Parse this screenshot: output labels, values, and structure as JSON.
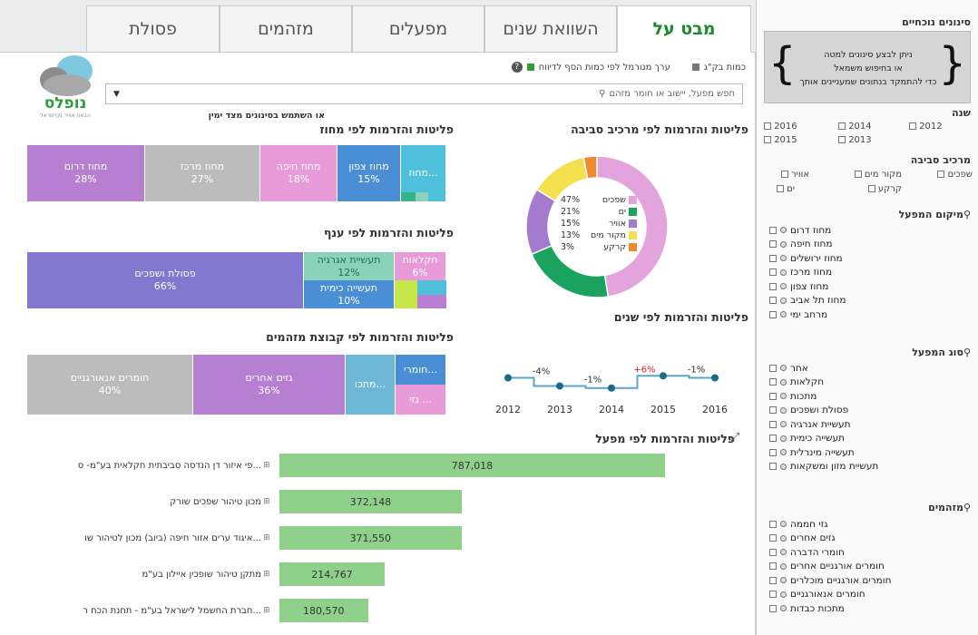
{
  "tabs": [
    {
      "label": "מבט על",
      "active": true
    },
    {
      "label": "השוואת שנים",
      "active": false
    },
    {
      "label": "מפעלים",
      "active": false
    },
    {
      "label": "מזהמים",
      "active": false
    },
    {
      "label": "פסולת",
      "active": false
    }
  ],
  "logo": {
    "text": "נופלס",
    "sub": "הבאת אוויר נקיישראל"
  },
  "legend": {
    "ton": "כמות בק\"ג",
    "normalized": "ערך מנורמל לפי כמות הסף לדיווח"
  },
  "search": {
    "placeholder": "חפש מפעל, יישוב או חומר מזהם",
    "note": "או השתמש בסינונים מצד ימין"
  },
  "sections": {
    "district": "פליטות והזרמות לפי מחוז",
    "env": "פליטות והזרמות לפי מרכיב סביבה",
    "branch": "פליטות והזרמות לפי ענף",
    "years": "פליטות והזרמות לפי שנים",
    "group": "פליטות והזרמות לפי קבוצת מזהמים",
    "factory": "פליטות והזרמות לפי מפעל"
  },
  "district_tiles": [
    {
      "name": "מחוז דרום",
      "pct": "28%",
      "color": "#b67fd1"
    },
    {
      "name": "מחוז מרכז",
      "pct": "27%",
      "color": "#bcbcbc"
    },
    {
      "name": "מחוז חיפה",
      "pct": "18%",
      "color": "#e89ad9"
    },
    {
      "name": "מחוז צפון",
      "pct": "15%",
      "color": "#4a8fd6"
    },
    {
      "name": "מחוז...",
      "pct": "",
      "color": "#4fc0dc"
    }
  ],
  "branch_tiles": [
    {
      "name": "פסולת ושפכים",
      "pct": "66%",
      "color": "#8377cf"
    },
    {
      "name": "תעשיית אגרגיה",
      "pct": "12%",
      "color": "#8ad2b9"
    },
    {
      "name": "תעשייה כימית",
      "pct": "10%",
      "color": "#4a8fd6"
    },
    {
      "name": "חקלאות",
      "pct": "6%",
      "color": "#e89ad9"
    }
  ],
  "group_tiles": [
    {
      "name": "חומרים אנאורגניים",
      "pct": "40%",
      "color": "#bcbcbc"
    },
    {
      "name": "גזים אחרים",
      "pct": "36%",
      "color": "#b67fd1"
    },
    {
      "name": "מתכו...",
      "pct": "",
      "color": "#6fb7d6"
    },
    {
      "name": "חומרי...",
      "pct": "",
      "color": "#4a8fd6"
    },
    {
      "name": "גזי ...",
      "pct": "",
      "color": "#e89ad9"
    }
  ],
  "donut": {
    "legend": [
      {
        "name": "שפכים",
        "pct": "47%",
        "color": "#e3a3dc"
      },
      {
        "name": "ים",
        "pct": "21%",
        "color": "#1aa35f"
      },
      {
        "name": "אוויר",
        "pct": "15%",
        "color": "#a57bd0"
      },
      {
        "name": "מקור מים",
        "pct": "13%",
        "color": "#f5e04f"
      },
      {
        "name": "קרקע",
        "pct": "3%",
        "color": "#f08a30"
      }
    ]
  },
  "chart_data": [
    {
      "type": "line",
      "title": "פליטות והזרמות לפי שנים",
      "x": [
        "2012",
        "2013",
        "2014",
        "2015",
        "2016"
      ],
      "series": [
        {
          "values": [
            100,
            96,
            95,
            101,
            100
          ]
        }
      ],
      "annotations": [
        "-4%",
        "-1%",
        "+6%",
        "-1%"
      ],
      "annotation_colors": [
        "#333",
        "#333",
        "#e0242c",
        "#333"
      ]
    },
    {
      "type": "pie",
      "title": "פליטות והזרמות לפי מרכיב סביבה",
      "categories": [
        "שפכים",
        "ים",
        "אוויר",
        "מקור מים",
        "קרקע"
      ],
      "values": [
        47,
        21,
        15,
        13,
        3
      ]
    },
    {
      "type": "bar",
      "title": "פליטות והזרמות לפי מפעל",
      "categories": [
        "...פי איזור דן הנדסה סביבתית חקלאית בע\"מ- ס",
        "מכון טיהור שפכים שורק",
        "...איגוד ערים אזור חיפה (ביוב) מכון לטיהור שו",
        "מתקן טיהור שופכין איילון בע\"מ",
        "...חברת החשמל לישראל בע\"מ - תחנת הכח ר"
      ],
      "values": [
        787018,
        372148,
        371550,
        214767,
        180570
      ],
      "labels": [
        "787,018",
        "372,148",
        "371,550",
        "214,767",
        "180,570"
      ]
    }
  ],
  "side": {
    "title": "סינונים נוכחיים",
    "info": [
      "ניתן לבצע סינונים למטה",
      "או בחיפוש משמאל",
      "כדי להתמקד בנתונים שמעניינים אותך"
    ],
    "year_title": "שנה",
    "years": [
      "2012",
      "2014",
      "2016",
      "2013",
      "2015"
    ],
    "env_title": "מרכיב סביבה",
    "env": [
      "שפכים",
      "מקור מים",
      "אוויר",
      "קרקע",
      "ים"
    ],
    "loc_title": "מיקום המפעל",
    "locs": [
      "מחוז דרום",
      "מחוז חיפה",
      "מחוז ירושלים",
      "מחוז מרכז",
      "מחוז צפון",
      "מחוז תל אביב",
      "מרחב ימי"
    ],
    "type_title": "סוג המפעל",
    "types": [
      "אחר",
      "חקלאות",
      "מתכות",
      "פסולת ושפכים",
      "תעשיית אנרגיה",
      "תעשייה כימית",
      "תעשייה מינרלית",
      "תעשיית מזון ומשקאות"
    ],
    "pol_title": "מזהמים",
    "pols": [
      "גזי חממה",
      "גזים אחרים",
      "חומרי הדברה",
      "חומרים אורגניים אחרים",
      "חומרים אורגניים מוכלרים",
      "חומרים אנאורגניים",
      "מתכות כבדות"
    ]
  }
}
